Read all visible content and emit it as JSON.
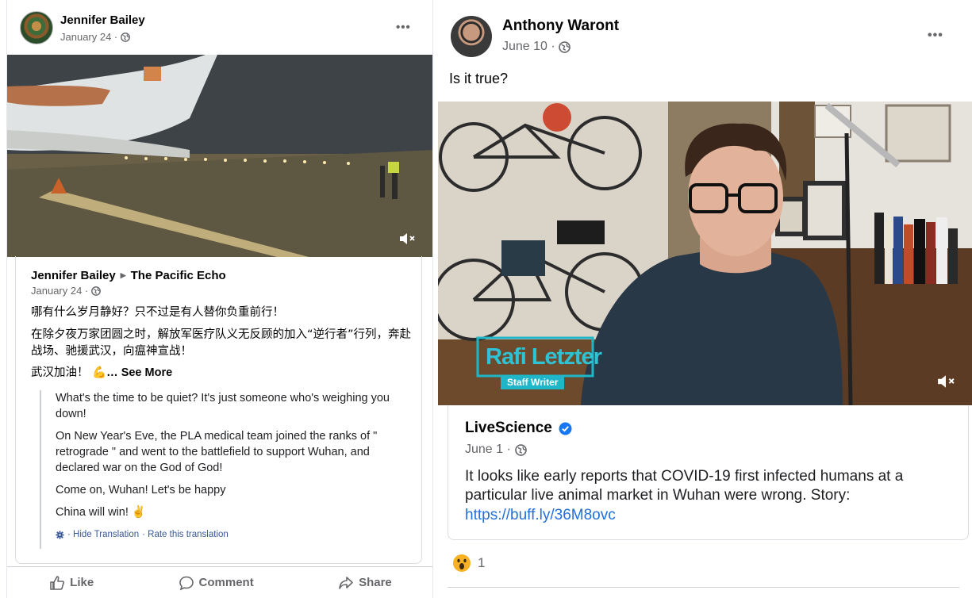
{
  "left_post": {
    "author": "Jennifer Bailey",
    "date": "January 24 ·",
    "menu": "•••",
    "shared_from": {
      "author": "Jennifer Bailey",
      "page": "The Pacific Echo",
      "date": "January 24 ·",
      "text_zh_1": "哪有什么岁月静好？只不过是有人替你负重前行！",
      "text_zh_2": "在除夕夜万家团圆之时，解放军医疗队义无反顾的加入“逆行者”行列，奔赴战场、驰援武汉，向瘟神宣战！",
      "text_zh_3": "武汉加油！",
      "see_more": "… See More"
    },
    "translation": {
      "p1": "What's the time to be quiet? It's just someone who's weighing you down!",
      "p2": "On New Year's Eve, the PLA medical team joined the ranks of \" retrograde \" and went to the battlefield to support Wuhan, and declared war on the God of God!",
      "p3": "Come on, Wuhan! Let's be happy",
      "p4": "China will win!",
      "hide_link": "· Hide Translation",
      "rate_link": "· Rate this translation"
    },
    "actions": {
      "like": "Like",
      "comment": "Comment",
      "share": "Share"
    }
  },
  "right_post": {
    "author": "Anthony Waront",
    "date": "June 10 ·",
    "menu": "•••",
    "caption": "Is it true?",
    "video_overlay": {
      "name": "Rafi Letzter",
      "title": "Staff Writer"
    },
    "link": {
      "source": "LiveScience",
      "date": "June 1 ·",
      "text": "It looks like early reports that COVID-19 first infected humans at a particular live animal market in Wuhan were wrong. Story:",
      "url": "https://buff.ly/36M8ovc"
    },
    "reactions": {
      "count": "1"
    }
  },
  "colors": {
    "link_blue": "#216fdb",
    "verified_blue": "#1877f2",
    "overlay_cyan": "#1fb6c7"
  }
}
